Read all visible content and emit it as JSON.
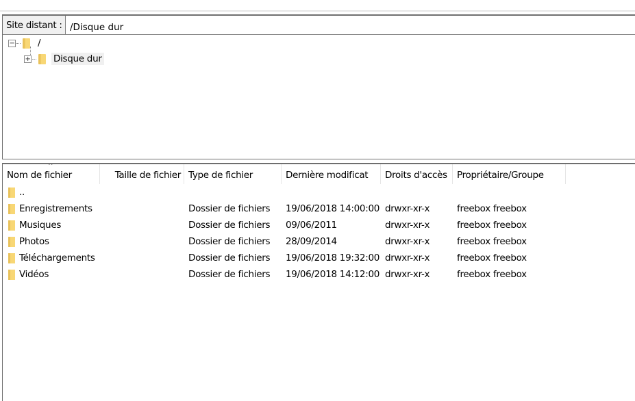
{
  "remote": {
    "label": "Site distant :",
    "path": "/Disque dur"
  },
  "tree": [
    {
      "label": "/",
      "expander": "minus"
    },
    {
      "label": "Disque dur",
      "expander": "plus",
      "selected": true
    }
  ],
  "columns": [
    "Nom de fichier",
    "Taille de fichier",
    "Type de fichier",
    "Dernière modificat",
    "Droits d'accès",
    "Propriétaire/Groupe"
  ],
  "sort_column": "Nom de fichier",
  "files": [
    {
      "name": "..",
      "size": "",
      "type": "",
      "modified": "",
      "perms": "",
      "owner": ""
    },
    {
      "name": "Enregistrements",
      "size": "",
      "type": "Dossier de fichiers",
      "modified": "19/06/2018 14:00:00",
      "perms": "drwxr-xr-x",
      "owner": "freebox freebox"
    },
    {
      "name": "Musiques",
      "size": "",
      "type": "Dossier de fichiers",
      "modified": "09/06/2011",
      "perms": "drwxr-xr-x",
      "owner": "freebox freebox"
    },
    {
      "name": "Photos",
      "size": "",
      "type": "Dossier de fichiers",
      "modified": "28/09/2014",
      "perms": "drwxr-xr-x",
      "owner": "freebox freebox"
    },
    {
      "name": "Téléchargements",
      "size": "",
      "type": "Dossier de fichiers",
      "modified": "19/06/2018 19:32:00",
      "perms": "drwxr-xr-x",
      "owner": "freebox freebox"
    },
    {
      "name": "Vidéos",
      "size": "",
      "type": "Dossier de fichiers",
      "modified": "19/06/2018 14:12:00",
      "perms": "drwxr-xr-x",
      "owner": "freebox freebox"
    }
  ]
}
